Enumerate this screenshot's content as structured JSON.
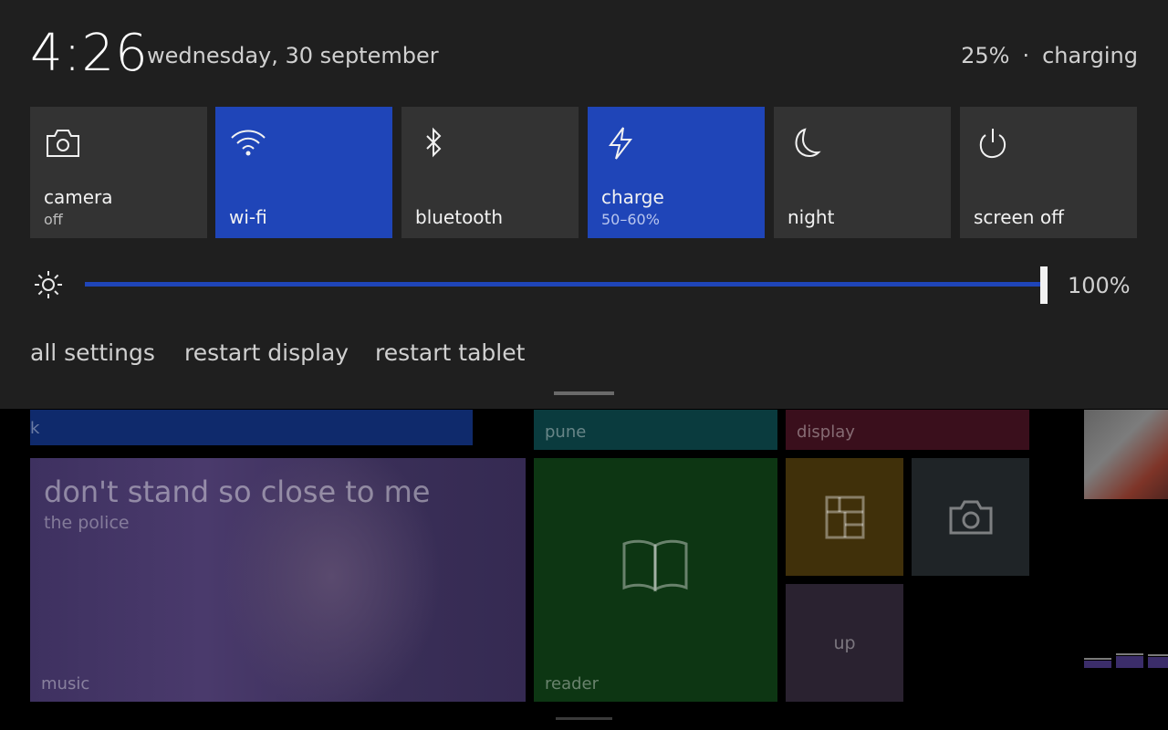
{
  "header": {
    "time": "4:26",
    "date": "wednesday, 30 september",
    "battery_percent": "25%",
    "separator": "·",
    "battery_state": "charging"
  },
  "quick_actions": [
    {
      "id": "camera",
      "label": "camera",
      "sublabel": "off",
      "active": false,
      "icon": "camera-icon"
    },
    {
      "id": "wifi",
      "label": "wi-fi",
      "sublabel": "",
      "active": true,
      "icon": "wifi-icon"
    },
    {
      "id": "bluetooth",
      "label": "bluetooth",
      "sublabel": "",
      "active": false,
      "icon": "bluetooth-icon"
    },
    {
      "id": "charge",
      "label": "charge",
      "sublabel": "50–60%",
      "active": true,
      "icon": "lightning-icon"
    },
    {
      "id": "night",
      "label": "night",
      "sublabel": "",
      "active": false,
      "icon": "moon-icon"
    },
    {
      "id": "screenoff",
      "label": "screen off",
      "sublabel": "",
      "active": false,
      "icon": "power-icon"
    }
  ],
  "brightness": {
    "icon": "sun-icon",
    "value_label": "100%",
    "level": 1.0
  },
  "links": {
    "all_settings": "all settings",
    "restart_display": "restart display",
    "restart_tablet": "restart tablet"
  },
  "tiles": {
    "blue_label": "k",
    "teal_label": "pune",
    "red_label": "display",
    "music_title": "don't stand so close to me",
    "music_artist": "the police",
    "music_label": "music",
    "reader_label": "reader",
    "up_label": "up"
  },
  "colors": {
    "accent": "#1f45b8",
    "panel": "#1f1f1f",
    "tile_off": "#333333"
  }
}
